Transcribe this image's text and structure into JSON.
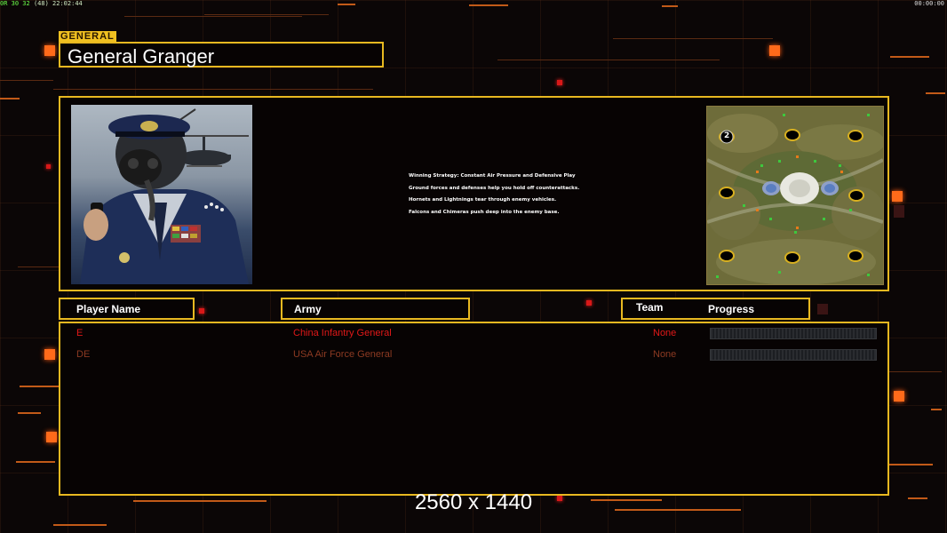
{
  "status_bar": {
    "fps_label": "0R",
    "fps_values": "30 32",
    "fps_extra": "(48)",
    "time": "22:02:44",
    "right_clock": "00:00:00"
  },
  "general": {
    "tag": "GENERAL",
    "name": "General Granger"
  },
  "info": {
    "strategy_lines": [
      "Winning Strategy: Constant Air Pressure and Defensive Play",
      "Ground forces and defenses help you hold off counterattacks.",
      "Hornets and Lightnings tear through enemy vehicles.",
      "Falcons and Chimeras push deep into the enemy base."
    ],
    "minimap_marker": "2"
  },
  "columns": {
    "player_name": "Player Name",
    "army": "Army",
    "team": "Team",
    "progress": "Progress"
  },
  "players": [
    {
      "name": "E",
      "army": "China Infantry General",
      "team": "None",
      "progress": 0,
      "color": "#e01818"
    },
    {
      "name": "DE",
      "army": "USA Air Force General",
      "team": "None",
      "progress": 0,
      "color": "#8c3a22"
    }
  ],
  "resolution_label": "2560 x 1440",
  "colors": {
    "accent": "#e8b820",
    "highlight": "#ff6a1a",
    "background": "#0b0606"
  }
}
